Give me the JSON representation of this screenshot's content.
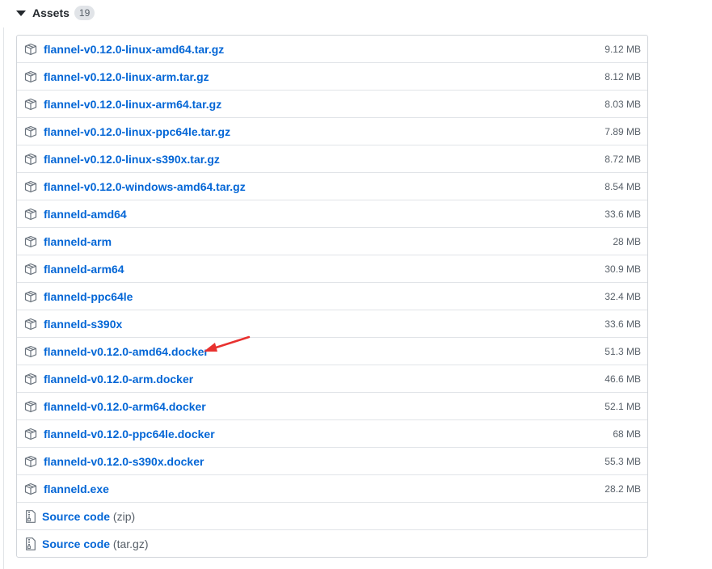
{
  "assets": {
    "title": "Assets",
    "count": "19",
    "items": [
      {
        "name": "flannel-v0.12.0-linux-amd64.tar.gz",
        "size": "9.12 MB"
      },
      {
        "name": "flannel-v0.12.0-linux-arm.tar.gz",
        "size": "8.12 MB"
      },
      {
        "name": "flannel-v0.12.0-linux-arm64.tar.gz",
        "size": "8.03 MB"
      },
      {
        "name": "flannel-v0.12.0-linux-ppc64le.tar.gz",
        "size": "7.89 MB"
      },
      {
        "name": "flannel-v0.12.0-linux-s390x.tar.gz",
        "size": "8.72 MB"
      },
      {
        "name": "flannel-v0.12.0-windows-amd64.tar.gz",
        "size": "8.54 MB"
      },
      {
        "name": "flanneld-amd64",
        "size": "33.6 MB"
      },
      {
        "name": "flanneld-arm",
        "size": "28 MB"
      },
      {
        "name": "flanneld-arm64",
        "size": "30.9 MB"
      },
      {
        "name": "flanneld-ppc64le",
        "size": "32.4 MB"
      },
      {
        "name": "flanneld-s390x",
        "size": "33.6 MB"
      },
      {
        "name": "flanneld-v0.12.0-amd64.docker",
        "size": "51.3 MB"
      },
      {
        "name": "flanneld-v0.12.0-arm.docker",
        "size": "46.6 MB"
      },
      {
        "name": "flanneld-v0.12.0-arm64.docker",
        "size": "52.1 MB"
      },
      {
        "name": "flanneld-v0.12.0-ppc64le.docker",
        "size": "68 MB"
      },
      {
        "name": "flanneld-v0.12.0-s390x.docker",
        "size": "55.3 MB"
      },
      {
        "name": "flanneld.exe",
        "size": "28.2 MB"
      }
    ],
    "source": [
      {
        "label": "Source code",
        "format": "(zip)"
      },
      {
        "label": "Source code",
        "format": "(tar.gz)"
      }
    ]
  },
  "icons": {
    "asset": "package-icon",
    "source": "file-zip-icon",
    "annotation": "red-arrow-icon"
  },
  "colors": {
    "link": "#0366d6",
    "muted": "#586069",
    "border": "#d1d5da",
    "annotation": "#e8312f"
  }
}
